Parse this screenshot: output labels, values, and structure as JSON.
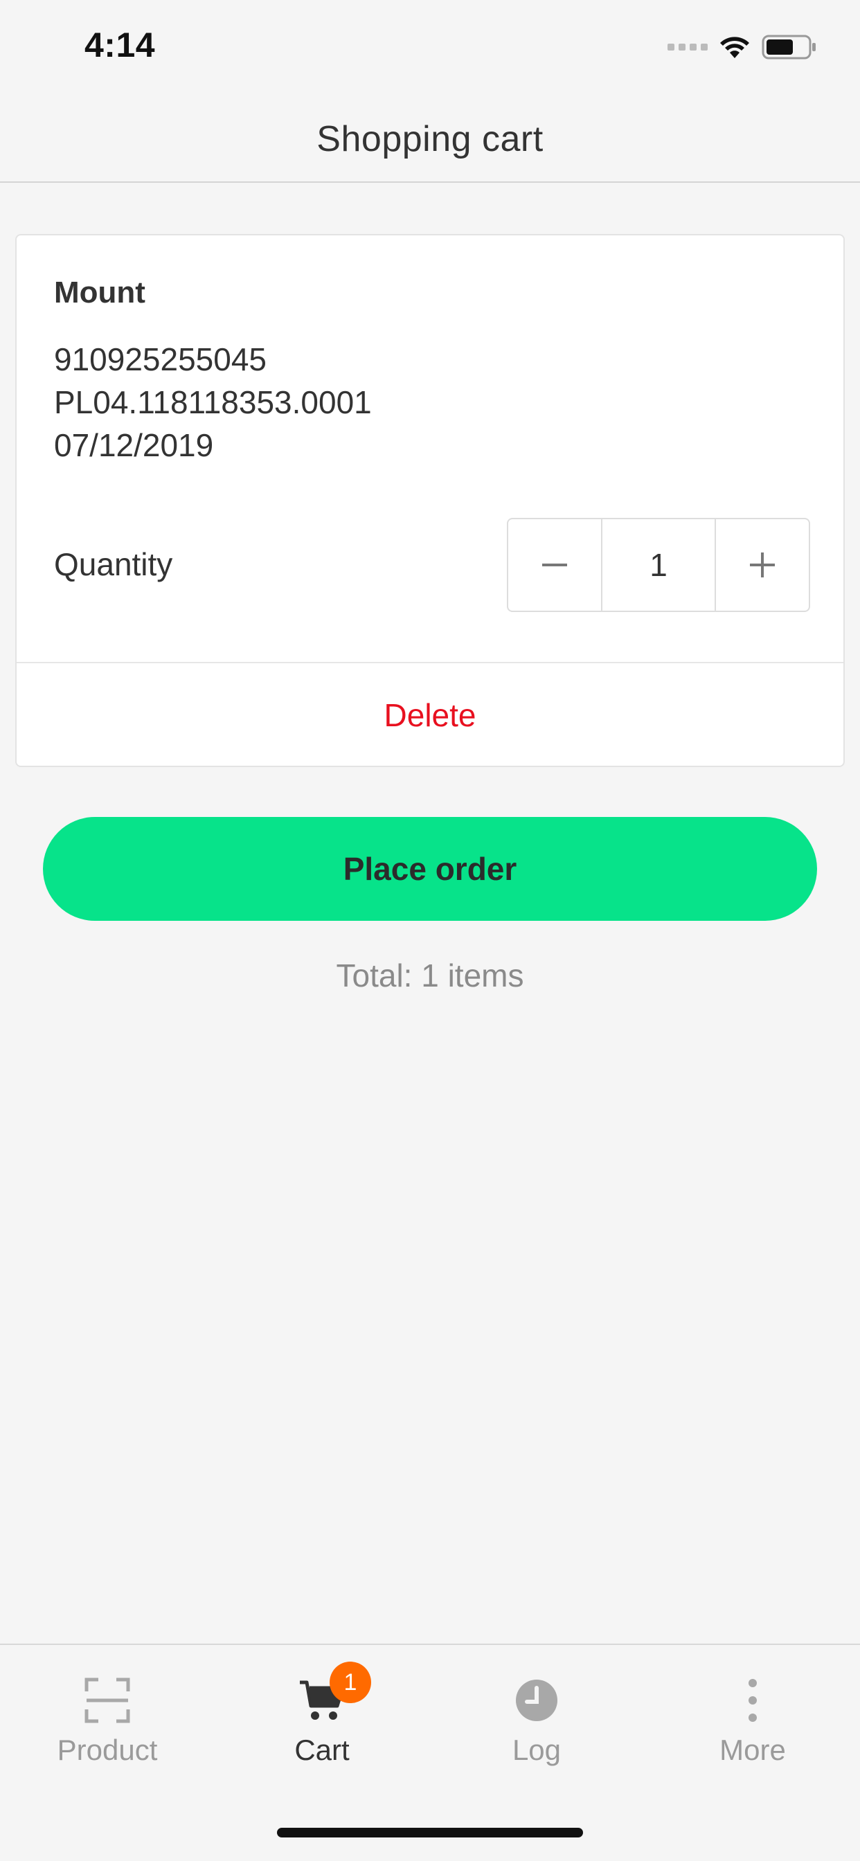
{
  "status_bar": {
    "time": "4:14"
  },
  "nav": {
    "title": "Shopping cart"
  },
  "cart_item": {
    "name": "Mount",
    "lines": [
      "910925255045",
      "PL04.118118353.0001",
      "07/12/2019"
    ],
    "quantity_label": "Quantity",
    "quantity_value": "1",
    "decrement_symbol": "−",
    "increment_symbol": "+",
    "delete_label": "Delete"
  },
  "actions": {
    "place_order_label": "Place order",
    "total_text": "Total: 1 items"
  },
  "tabs": [
    {
      "label": "Product",
      "icon": "scan-icon",
      "active": false
    },
    {
      "label": "Cart",
      "icon": "cart-icon",
      "active": true,
      "badge": "1"
    },
    {
      "label": "Log",
      "icon": "clock-icon",
      "active": false
    },
    {
      "label": "More",
      "icon": "more-vertical-icon",
      "active": false
    }
  ],
  "colors": {
    "accent_green": "#07e38a",
    "delete_red": "#e8101f",
    "badge_orange": "#ff6a00",
    "background": "#f5f5f5"
  }
}
